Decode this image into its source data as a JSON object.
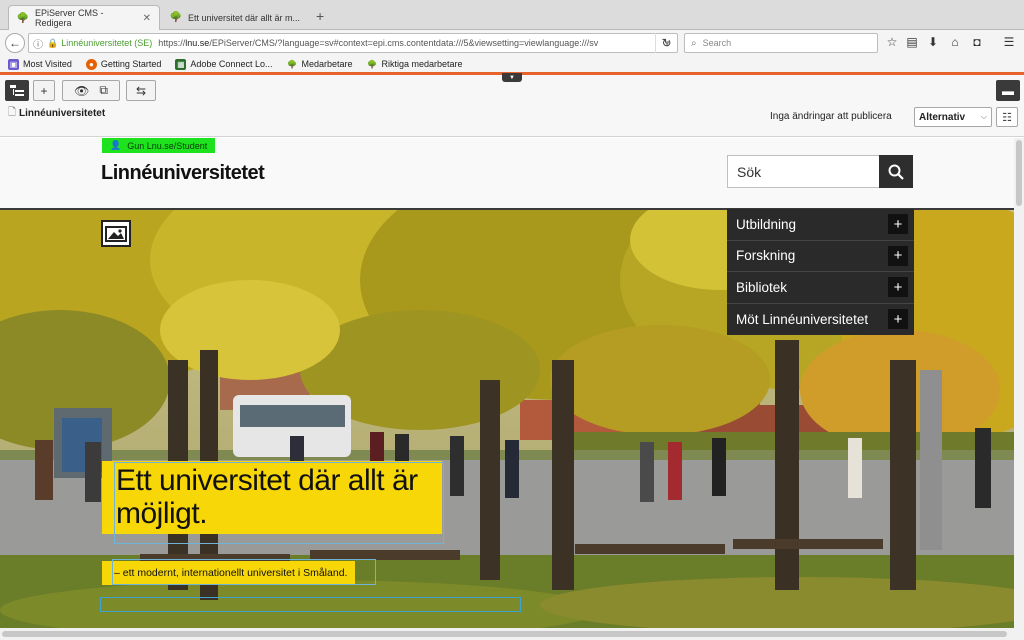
{
  "browser": {
    "tabs": [
      {
        "label": "EPiServer CMS - Redigera",
        "active": true
      },
      {
        "label": "Ett universitet där allt är m...",
        "active": false
      }
    ],
    "url": {
      "site_label": "Linnéuniversitetet (SE)",
      "prefix": "https://",
      "host": "lnu.se",
      "path": "/EPiServer/CMS/?language=sv#context=epi.cms.contentdata:///5&viewsetting=viewlanguage:///sv"
    },
    "search_placeholder": "Search",
    "bookmarks": [
      {
        "label": "Most Visited",
        "icon": "most-visited-icon"
      },
      {
        "label": "Getting Started",
        "icon": "firefox-icon"
      },
      {
        "label": "Adobe Connect Lo...",
        "icon": "adobe-icon"
      },
      {
        "label": "Medarbetare",
        "icon": "lnu-icon"
      },
      {
        "label": "Riktiga medarbetare",
        "icon": "lnu-icon"
      }
    ]
  },
  "cms": {
    "breadcrumb": "Linnéuniversitetet",
    "status": "Inga ändringar att publicera",
    "options_label": "Alternativ"
  },
  "site": {
    "user_badge": "Gun Lnu.se/Student",
    "logo": "Linnéuniversitetet",
    "search_value": "Sök",
    "menu": [
      {
        "label": "Utbildning"
      },
      {
        "label": "Forskning"
      },
      {
        "label": "Bibliotek"
      },
      {
        "label": "Möt Linnéuniversitetet"
      }
    ],
    "headline": "Ett universitet där allt är möjligt.",
    "subline": "– ett modernt, internationellt universitet i Småland.",
    "plus": "+"
  },
  "colors": {
    "accent_orange": "#e8632c",
    "highlight_yellow": "#f7d708",
    "user_green": "#1de21d",
    "menu_dark": "#2a2a2a"
  }
}
